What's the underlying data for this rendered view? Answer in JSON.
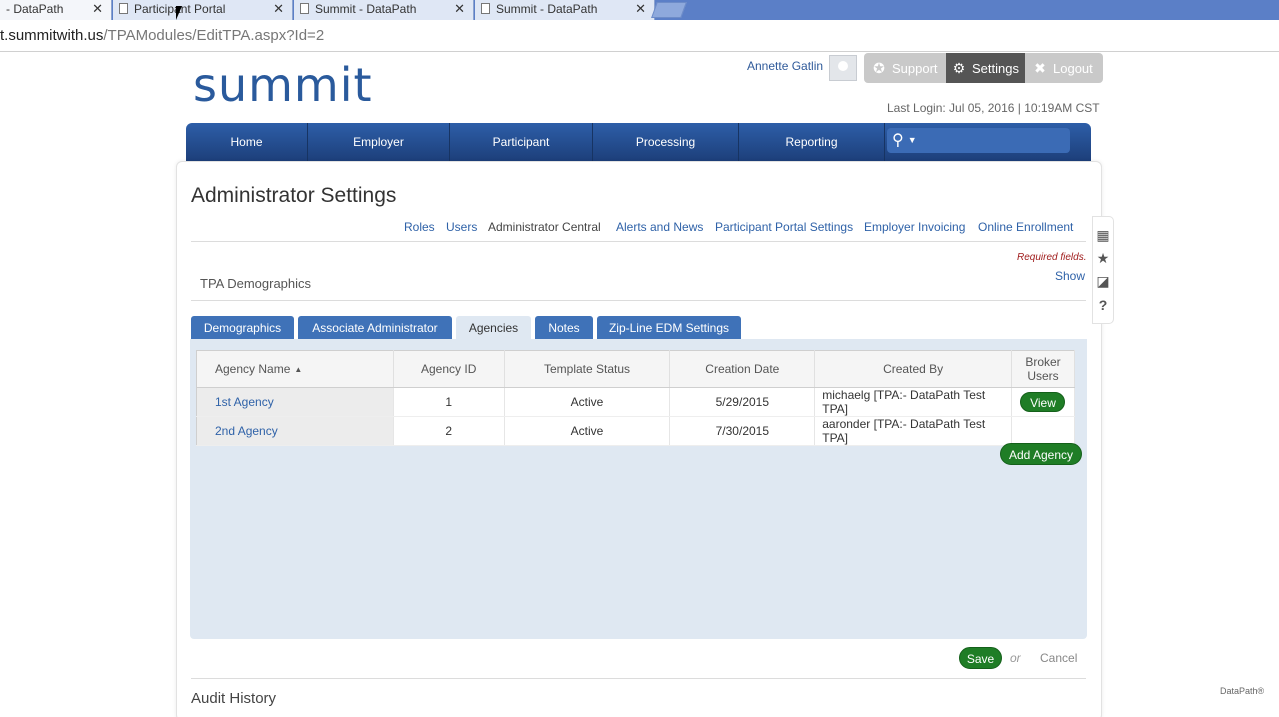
{
  "browser": {
    "tabs": [
      {
        "title": "- DataPath"
      },
      {
        "title": "Participant Portal"
      },
      {
        "title": "Summit - DataPath"
      },
      {
        "title": "Summit - DataPath"
      }
    ],
    "url_host": "t.summitwith.us",
    "url_path": "/TPAModules/EditTPA.aspx?Id=2"
  },
  "header": {
    "logo": "summit",
    "user_name": "Annette Gatlin",
    "support_label": "Support",
    "settings_label": "Settings",
    "logout_label": "Logout",
    "last_login": "Last Login: Jul 05, 2016 | 10:19AM CST"
  },
  "nav": {
    "items": [
      "Home",
      "Employer",
      "Participant",
      "Processing",
      "Reporting"
    ]
  },
  "page": {
    "title": "Administrator Settings",
    "subnav": [
      "Roles",
      "Users",
      "Administrator Central",
      "Alerts and News",
      "Participant Portal Settings",
      "Employer Invoicing",
      "Online Enrollment"
    ],
    "required_fields": "Required fields.",
    "show_label": "Show",
    "section_title": "TPA Demographics"
  },
  "tabs": [
    "Demographics",
    "Associate Administrator",
    "Agencies",
    "Notes",
    "Zip-Line EDM Settings"
  ],
  "agencies_table": {
    "columns": [
      "Agency Name",
      "Agency ID",
      "Template Status",
      "Creation Date",
      "Created By",
      "Broker Users"
    ],
    "rows": [
      {
        "name": "1st Agency",
        "id": "1",
        "status": "Active",
        "date": "5/29/2015",
        "created_by": "michaelg [TPA:- DataPath Test TPA]",
        "broker": "View"
      },
      {
        "name": "2nd Agency",
        "id": "2",
        "status": "Active",
        "date": "7/30/2015",
        "created_by": "aaronder [TPA:- DataPath Test TPA]",
        "broker": ""
      }
    ]
  },
  "actions": {
    "add_agency": "Add Agency",
    "save": "Save",
    "or": "or",
    "cancel": "Cancel"
  },
  "audit_title": "Audit History",
  "footer_brand": "DataPath",
  "colors": {
    "nav_blue": "#1d3f7a",
    "tab_blue": "#3f72b8",
    "action_green": "#1f7d26",
    "link_blue": "#2f62a8"
  }
}
